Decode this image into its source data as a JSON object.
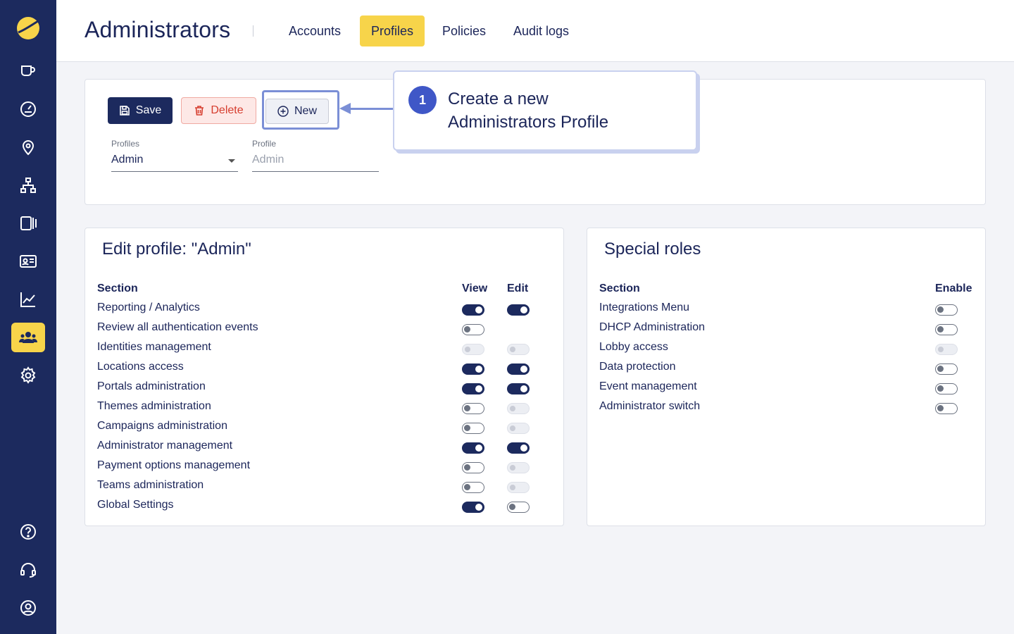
{
  "colors": {
    "sidebar": "#1c2a5e",
    "accent": "#f7d44a",
    "primary": "#1c2a5e",
    "danger": "#d63d2e",
    "callout": "#3f57c7"
  },
  "sidebar": {
    "logo": "sun-logo-icon",
    "items": [
      {
        "icon": "coffee-cup-icon"
      },
      {
        "icon": "dashboard-gauge-icon"
      },
      {
        "icon": "location-pin-icon"
      },
      {
        "icon": "network-icon"
      },
      {
        "icon": "display-icon"
      },
      {
        "icon": "id-card-icon"
      },
      {
        "icon": "line-chart-icon"
      },
      {
        "icon": "users-icon",
        "active": true
      },
      {
        "icon": "gear-icon"
      }
    ],
    "bottom": [
      {
        "icon": "help-icon"
      },
      {
        "icon": "headset-icon"
      },
      {
        "icon": "user-profile-icon"
      }
    ]
  },
  "header": {
    "title": "Administrators",
    "tabs": [
      {
        "label": "Accounts"
      },
      {
        "label": "Profiles",
        "active": true
      },
      {
        "label": "Policies"
      },
      {
        "label": "Audit logs"
      }
    ]
  },
  "toolbar": {
    "save_label": "Save",
    "delete_label": "Delete",
    "new_label": "New"
  },
  "fields": {
    "profiles_label": "Profiles",
    "profiles_value": "Admin",
    "profile_label": "Profile",
    "profile_placeholder": "Admin"
  },
  "callout": {
    "number": "1",
    "text_line1": "Create a new",
    "text_line2": "Administrators Profile"
  },
  "edit_profile": {
    "title": "Edit profile: \"Admin\"",
    "col_section": "Section",
    "col_view": "View",
    "col_edit": "Edit",
    "rows": [
      {
        "label": "Reporting / Analytics",
        "view": "on",
        "edit": "on"
      },
      {
        "label": "Review all authentication events",
        "view": "off",
        "edit": "none"
      },
      {
        "label": "Identities management",
        "view": "disabled",
        "edit": "disabled"
      },
      {
        "label": "Locations access",
        "view": "on",
        "edit": "on"
      },
      {
        "label": "Portals administration",
        "view": "on",
        "edit": "on"
      },
      {
        "label": "Themes administration",
        "view": "off",
        "edit": "disabled"
      },
      {
        "label": "Campaigns administration",
        "view": "off",
        "edit": "disabled"
      },
      {
        "label": "Administrator management",
        "view": "on",
        "edit": "on"
      },
      {
        "label": "Payment options management",
        "view": "off",
        "edit": "disabled"
      },
      {
        "label": "Teams administration",
        "view": "off",
        "edit": "disabled"
      },
      {
        "label": "Global Settings",
        "view": "on",
        "edit": "off"
      }
    ]
  },
  "special_roles": {
    "title": "Special roles",
    "col_section": "Section",
    "col_enable": "Enable",
    "rows": [
      {
        "label": "Integrations Menu",
        "enable": "off"
      },
      {
        "label": "DHCP Administration",
        "enable": "off"
      },
      {
        "label": "Lobby access",
        "enable": "disabled"
      },
      {
        "label": "Data protection",
        "enable": "off"
      },
      {
        "label": "Event management",
        "enable": "off"
      },
      {
        "label": "Administrator switch",
        "enable": "off"
      }
    ]
  }
}
